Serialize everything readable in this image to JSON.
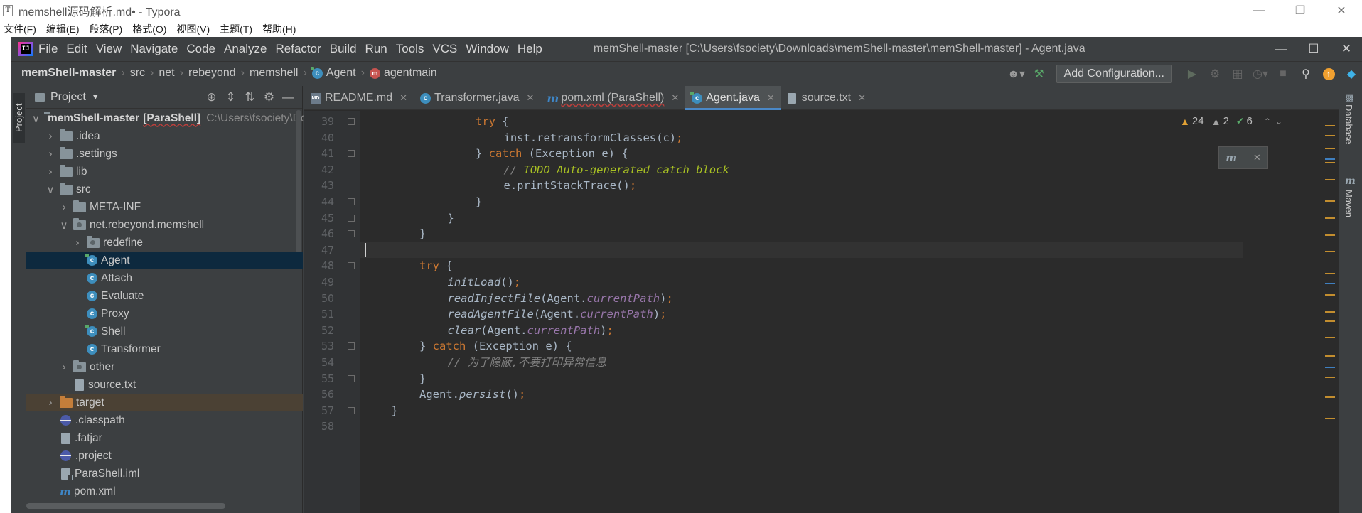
{
  "typora": {
    "icon_glyph": "T",
    "title": "memshell源码解析.md• - Typora",
    "menus": [
      "文件(F)",
      "编辑(E)",
      "段落(P)",
      "格式(O)",
      "视图(V)",
      "主题(T)",
      "帮助(H)"
    ]
  },
  "idea": {
    "logo_text": "IJ",
    "menus": [
      "File",
      "Edit",
      "View",
      "Navigate",
      "Code",
      "Analyze",
      "Refactor",
      "Build",
      "Run",
      "Tools",
      "VCS",
      "Window",
      "Help"
    ],
    "window_title": "memShell-master [C:\\Users\\fsociety\\Downloads\\memShell-master\\memShell-master] - Agent.java",
    "breadcrumbs": [
      "memShell-master",
      "src",
      "net",
      "rebeyond",
      "memshell",
      "Agent",
      "agentmain"
    ],
    "add_configuration": "Add Configuration..."
  },
  "project_panel": {
    "header": "Project",
    "left_strip_label": "Project",
    "tree": [
      {
        "indent": 0,
        "arrow": "down",
        "icon": "folder",
        "label": "memShell-master",
        "module": "[ParaShell]",
        "path": "C:\\Users\\fsociety\\Downloads\\memShell-master\\memShell-master",
        "root": true
      },
      {
        "indent": 1,
        "arrow": "right",
        "icon": "folder",
        "label": ".idea"
      },
      {
        "indent": 1,
        "arrow": "right",
        "icon": "folder",
        "label": ".settings"
      },
      {
        "indent": 1,
        "arrow": "right",
        "icon": "folder",
        "label": "lib"
      },
      {
        "indent": 1,
        "arrow": "down",
        "icon": "folder",
        "label": "src"
      },
      {
        "indent": 2,
        "arrow": "right",
        "icon": "folder",
        "label": "META-INF"
      },
      {
        "indent": 2,
        "arrow": "down",
        "icon": "package",
        "label": "net.rebeyond.memshell"
      },
      {
        "indent": 3,
        "arrow": "right",
        "icon": "package",
        "label": "redefine"
      },
      {
        "indent": 3,
        "arrow": "none",
        "icon": "class-run",
        "label": "Agent",
        "selected": true
      },
      {
        "indent": 3,
        "arrow": "none",
        "icon": "class",
        "label": "Attach"
      },
      {
        "indent": 3,
        "arrow": "none",
        "icon": "class",
        "label": "Evaluate"
      },
      {
        "indent": 3,
        "arrow": "none",
        "icon": "class",
        "label": "Proxy"
      },
      {
        "indent": 3,
        "arrow": "none",
        "icon": "class-run",
        "label": "Shell"
      },
      {
        "indent": 3,
        "arrow": "none",
        "icon": "class",
        "label": "Transformer"
      },
      {
        "indent": 2,
        "arrow": "right",
        "icon": "package",
        "label": "other"
      },
      {
        "indent": 2,
        "arrow": "none",
        "icon": "file",
        "label": "source.txt"
      },
      {
        "indent": 1,
        "arrow": "right",
        "icon": "folder-orange",
        "label": "target",
        "excluded": true
      },
      {
        "indent": 1,
        "arrow": "none",
        "icon": "eclipse",
        "label": ".classpath"
      },
      {
        "indent": 1,
        "arrow": "none",
        "icon": "file",
        "label": ".fatjar"
      },
      {
        "indent": 1,
        "arrow": "none",
        "icon": "eclipse",
        "label": ".project"
      },
      {
        "indent": 1,
        "arrow": "none",
        "icon": "iml",
        "label": "ParaShell.iml"
      },
      {
        "indent": 1,
        "arrow": "none",
        "icon": "maven",
        "label": "pom.xml"
      }
    ]
  },
  "editor": {
    "tabs": [
      {
        "label": "README.md",
        "icon": "md",
        "active": false,
        "error": false
      },
      {
        "label": "Transformer.java",
        "icon": "class",
        "active": false,
        "error": false
      },
      {
        "label": "pom.xml (ParaShell)",
        "icon": "maven",
        "active": false,
        "error": true
      },
      {
        "label": "Agent.java",
        "icon": "class-run",
        "active": true,
        "error": false
      },
      {
        "label": "source.txt",
        "icon": "txt",
        "active": false,
        "error": false
      }
    ],
    "inspections": {
      "warnings": "24",
      "weak_warnings": "2",
      "ok": "6"
    },
    "current_line": 47,
    "lines": [
      {
        "n": "39",
        "indent": 4,
        "tokens": [
          [
            "kw",
            "try"
          ],
          [
            "pl",
            " {"
          ]
        ],
        "fold": true
      },
      {
        "n": "40",
        "indent": 5,
        "tokens": [
          [
            "pl",
            "inst.retransformClasses(c)"
          ],
          [
            "kw",
            ";"
          ]
        ]
      },
      {
        "n": "41",
        "indent": 4,
        "tokens": [
          [
            "pl",
            "} "
          ],
          [
            "kw",
            "catch"
          ],
          [
            "pl",
            " (Exception e) {"
          ]
        ],
        "fold": true
      },
      {
        "n": "42",
        "indent": 5,
        "tokens": [
          [
            "cm",
            "// "
          ],
          [
            "todo",
            "TODO Auto-generated catch block"
          ]
        ]
      },
      {
        "n": "43",
        "indent": 5,
        "tokens": [
          [
            "pl",
            "e.printStackTrace()"
          ],
          [
            "kw",
            ";"
          ]
        ]
      },
      {
        "n": "44",
        "indent": 4,
        "tokens": [
          [
            "pl",
            "}"
          ]
        ],
        "fold": true
      },
      {
        "n": "45",
        "indent": 3,
        "tokens": [
          [
            "pl",
            "}"
          ]
        ],
        "fold": true
      },
      {
        "n": "46",
        "indent": 2,
        "tokens": [
          [
            "pl",
            "}"
          ]
        ],
        "fold": true
      },
      {
        "n": "47",
        "indent": 0,
        "tokens": [
          [
            "pl",
            ""
          ]
        ]
      },
      {
        "n": "48",
        "indent": 2,
        "tokens": [
          [
            "kw",
            "try"
          ],
          [
            "pl",
            " {"
          ]
        ],
        "fold": true
      },
      {
        "n": "49",
        "indent": 3,
        "tokens": [
          [
            "fn",
            "initLoad"
          ],
          [
            "pl",
            "()"
          ],
          [
            "kw",
            ";"
          ]
        ]
      },
      {
        "n": "50",
        "indent": 3,
        "tokens": [
          [
            "fn",
            "readInjectFile"
          ],
          [
            "pl",
            "(Agent."
          ],
          [
            "field",
            "currentPath"
          ],
          [
            "pl",
            ")"
          ],
          [
            "kw",
            ";"
          ]
        ]
      },
      {
        "n": "51",
        "indent": 3,
        "tokens": [
          [
            "fn",
            "readAgentFile"
          ],
          [
            "pl",
            "(Agent."
          ],
          [
            "field",
            "currentPath"
          ],
          [
            "pl",
            ")"
          ],
          [
            "kw",
            ";"
          ]
        ]
      },
      {
        "n": "52",
        "indent": 3,
        "tokens": [
          [
            "fn",
            "clear"
          ],
          [
            "pl",
            "(Agent."
          ],
          [
            "field",
            "currentPath"
          ],
          [
            "pl",
            ")"
          ],
          [
            "kw",
            ";"
          ]
        ]
      },
      {
        "n": "53",
        "indent": 2,
        "tokens": [
          [
            "pl",
            "} "
          ],
          [
            "kw",
            "catch"
          ],
          [
            "pl",
            " (Exception e) {"
          ]
        ],
        "fold": true
      },
      {
        "n": "54",
        "indent": 3,
        "tokens": [
          [
            "cm",
            "// 为了隐蔽,不要打印异常信息"
          ]
        ]
      },
      {
        "n": "55",
        "indent": 2,
        "tokens": [
          [
            "pl",
            "}"
          ]
        ],
        "fold": true
      },
      {
        "n": "56",
        "indent": 2,
        "tokens": [
          [
            "pl",
            "Agent."
          ],
          [
            "fn",
            "persist"
          ],
          [
            "pl",
            "()"
          ],
          [
            "kw",
            ";"
          ]
        ]
      },
      {
        "n": "57",
        "indent": 1,
        "tokens": [
          [
            "pl",
            "}"
          ]
        ],
        "fold": true
      },
      {
        "n": "58",
        "indent": 0,
        "tokens": [
          [
            "pl",
            ""
          ]
        ]
      }
    ]
  },
  "right_strip": {
    "database": "Database",
    "maven": "Maven"
  },
  "colors": {
    "keyword": "#cc7832",
    "comment": "#808080",
    "todo": "#a8c023",
    "field": "#9876aa",
    "accent": "#4a88c7",
    "selection": "#0d293e"
  }
}
